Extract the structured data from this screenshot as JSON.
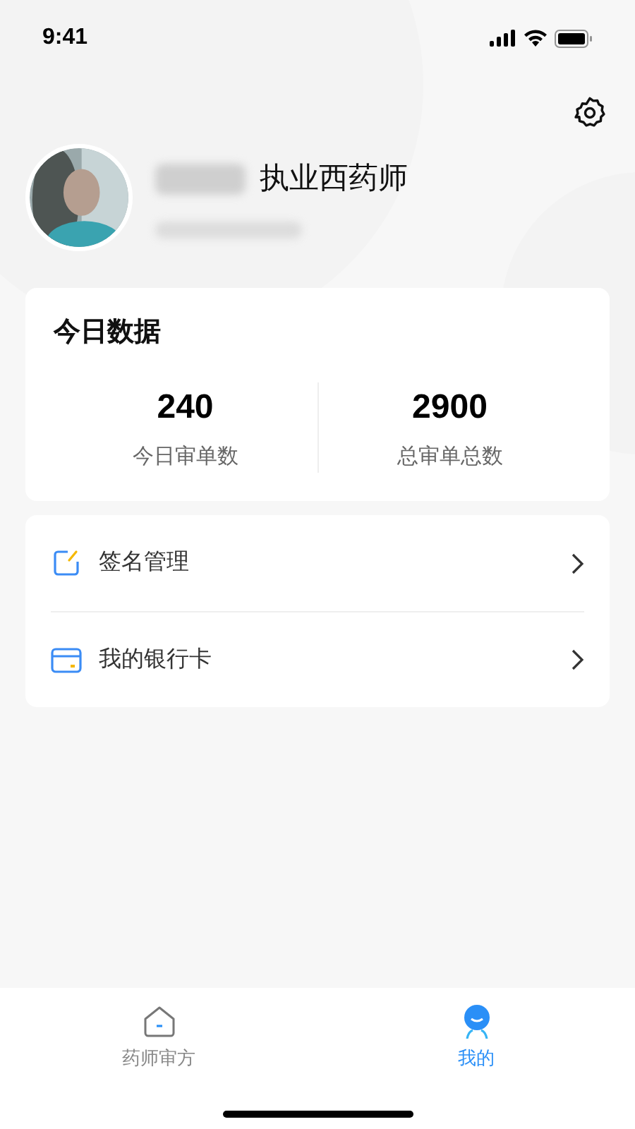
{
  "status_bar": {
    "time": "9:41"
  },
  "profile": {
    "title": "执业西药师"
  },
  "stats_card": {
    "title": "今日数据",
    "stats": [
      {
        "value": "240",
        "label": "今日审单数"
      },
      {
        "value": "2900",
        "label": "总审单总数"
      }
    ]
  },
  "menu": [
    {
      "kind": "signature",
      "label": "签名管理"
    },
    {
      "kind": "bank-card",
      "label": "我的银行卡"
    }
  ],
  "tab_bar": [
    {
      "kind": "home",
      "label": "药师审方",
      "selected": false
    },
    {
      "kind": "person",
      "label": "我的",
      "selected": true
    }
  ]
}
